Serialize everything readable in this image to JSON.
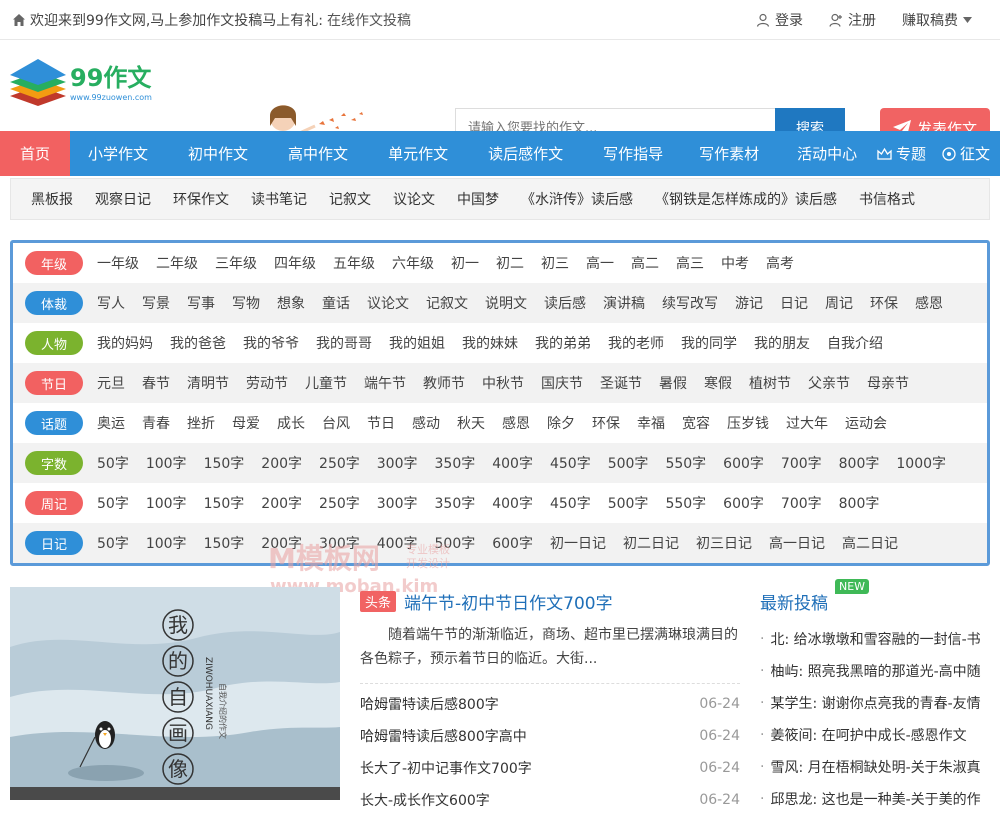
{
  "topbar": {
    "welcome": "欢迎来到99作文网,马上参加作文投稿马上有礼:",
    "link": "在线作文投稿",
    "login": "登录",
    "register": "注册",
    "earn": "赚取稿费"
  },
  "header": {
    "logo_text": "99作文",
    "logo_url_text": "www.99zuowen.com",
    "search_placeholder": "请输入您要找的作文...",
    "search_button": "搜索",
    "post_button": "发表作文"
  },
  "nav": {
    "items": [
      "首页",
      "小学作文",
      "初中作文",
      "高中作文",
      "单元作文",
      "读后感作文",
      "写作指导",
      "写作素材",
      "活动中心"
    ],
    "special": "专题",
    "contest": "征文"
  },
  "subnav": [
    "黑板报",
    "观察日记",
    "环保作文",
    "读书笔记",
    "记叙文",
    "议论文",
    "中国梦",
    "《水浒传》读后感",
    "《钢铁是怎样炼成的》读后感",
    "书信格式"
  ],
  "tag_rows": [
    {
      "label": "年级",
      "color": "#f26161",
      "tags": [
        "一年级",
        "二年级",
        "三年级",
        "四年级",
        "五年级",
        "六年级",
        "初一",
        "初二",
        "初三",
        "高一",
        "高二",
        "高三",
        "中考",
        "高考"
      ]
    },
    {
      "label": "体裁",
      "color": "#2f8fd8",
      "tags": [
        "写人",
        "写景",
        "写事",
        "写物",
        "想象",
        "童话",
        "议论文",
        "记叙文",
        "说明文",
        "读后感",
        "演讲稿",
        "续写改写",
        "游记",
        "日记",
        "周记",
        "环保",
        "感恩"
      ]
    },
    {
      "label": "人物",
      "color": "#7bb32e",
      "tags": [
        "我的妈妈",
        "我的爸爸",
        "我的爷爷",
        "我的哥哥",
        "我的姐姐",
        "我的妹妹",
        "我的弟弟",
        "我的老师",
        "我的同学",
        "我的朋友",
        "自我介绍"
      ]
    },
    {
      "label": "节日",
      "color": "#f26161",
      "tags": [
        "元旦",
        "春节",
        "清明节",
        "劳动节",
        "儿童节",
        "端午节",
        "教师节",
        "中秋节",
        "国庆节",
        "圣诞节",
        "暑假",
        "寒假",
        "植树节",
        "父亲节",
        "母亲节"
      ]
    },
    {
      "label": "话题",
      "color": "#2f8fd8",
      "tags": [
        "奥运",
        "青春",
        "挫折",
        "母爱",
        "成长",
        "台风",
        "节日",
        "感动",
        "秋天",
        "感恩",
        "除夕",
        "环保",
        "幸福",
        "宽容",
        "压岁钱",
        "过大年",
        "运动会"
      ]
    },
    {
      "label": "字数",
      "color": "#7bb32e",
      "tags": [
        "50字",
        "100字",
        "150字",
        "200字",
        "250字",
        "300字",
        "350字",
        "400字",
        "450字",
        "500字",
        "550字",
        "600字",
        "700字",
        "800字",
        "1000字"
      ]
    },
    {
      "label": "周记",
      "color": "#f26161",
      "tags": [
        "50字",
        "100字",
        "150字",
        "200字",
        "250字",
        "300字",
        "350字",
        "400字",
        "450字",
        "500字",
        "550字",
        "600字",
        "700字",
        "800字"
      ]
    },
    {
      "label": "日记",
      "color": "#2f8fd8",
      "tags": [
        "50字",
        "100字",
        "150字",
        "200字",
        "300字",
        "400字",
        "500字",
        "600字",
        "初一日记",
        "初二日记",
        "初三日记",
        "高一日记",
        "高二日记"
      ]
    }
  ],
  "watermark": {
    "brand": "M模板网",
    "slogan1": "专业模板",
    "slogan2": "开发设计",
    "url": "www.moban.kim"
  },
  "thumbnail": {
    "title": "我的自画像",
    "side_text": "ZIWOHUAXIANG",
    "side_text2": "自我介绍的作文"
  },
  "headline": {
    "badge": "头条",
    "title": "端午节-初中节日作文700字",
    "summary": "随着端午节的渐渐临近，商场、超市里已摆满琳琅满目的各色粽子，预示着节日的临近。大街..."
  },
  "articles": [
    {
      "title": "哈姆雷特读后感800字",
      "date": "06-24"
    },
    {
      "title": "哈姆雷特读后感800字高中",
      "date": "06-24"
    },
    {
      "title": "长大了-初中记事作文700字",
      "date": "06-24"
    },
    {
      "title": "长大-成长作文600字",
      "date": "06-24"
    }
  ],
  "latest": {
    "title": "最新投稿",
    "new_tag": "NEW",
    "items": [
      "北: 给冰墩墩和雪容融的一封信-书",
      "柚屿: 照亮我黑暗的那道光-高中随",
      "某学生: 谢谢你点亮我的青春-友情",
      "姜筱间: 在呵护中成长-感恩作文",
      "雪风: 月在梧桐缺处明-关于朱淑真",
      "邱思龙: 这也是一种美-关于美的作"
    ]
  }
}
